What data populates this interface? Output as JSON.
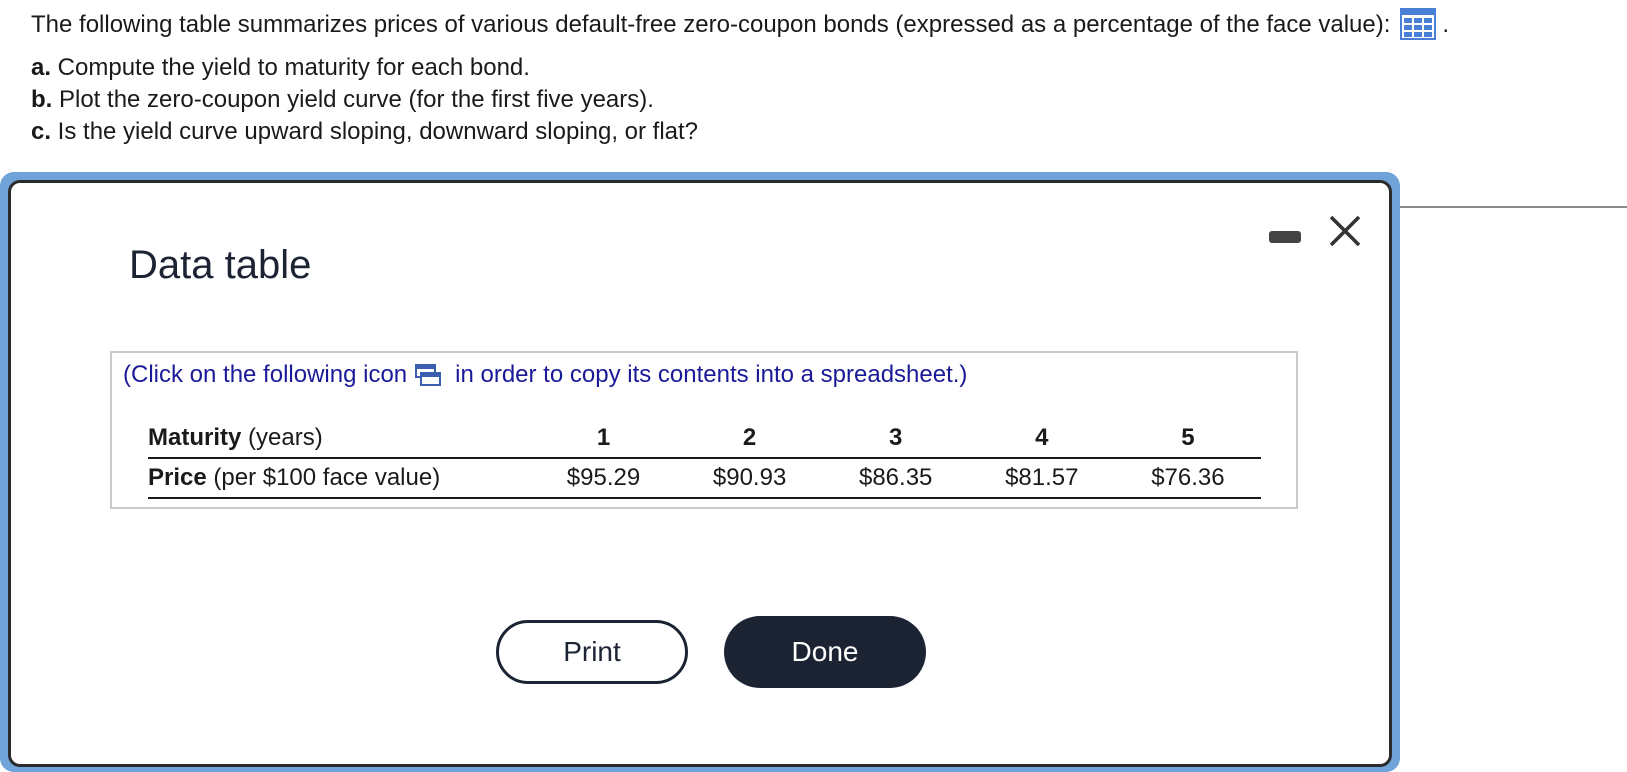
{
  "question": {
    "intro": "The following table summarizes prices of various default-free zero-coupon bonds (expressed as a percentage of the face value):",
    "intro_suffix": ".",
    "parts": [
      {
        "letter": "a.",
        "text": " Compute the yield to maturity for each bond."
      },
      {
        "letter": "b.",
        "text": " Plot the zero-coupon yield curve (for the first five years)."
      },
      {
        "letter": "c.",
        "text": " Is the yield curve upward sloping, downward sloping, or flat?"
      }
    ]
  },
  "dialog": {
    "title": "Data table",
    "copy_note_before": "(Click on the following icon",
    "copy_note_after": "in order to copy its contents into a spreadsheet.)",
    "table": {
      "maturity_label_bold": "Maturity",
      "maturity_label_rest": " (years)",
      "price_label_bold": "Price",
      "price_label_rest": " (per $100 face value)",
      "maturities": [
        "1",
        "2",
        "3",
        "4",
        "5"
      ],
      "prices": [
        "$95.29",
        "$90.93",
        "$86.35",
        "$81.57",
        "$76.36"
      ]
    },
    "print_label": "Print",
    "done_label": "Done"
  },
  "colors": {
    "accent_blue": "#6fa3d9",
    "link_blue": "#1a1a99",
    "dark_button": "#1c2333"
  },
  "icons": {
    "table_icon": "grid-table-icon",
    "copy_icon": "spreadsheet-copy-icon",
    "minimize_icon": "minimize-icon",
    "close_icon": "close-icon"
  }
}
